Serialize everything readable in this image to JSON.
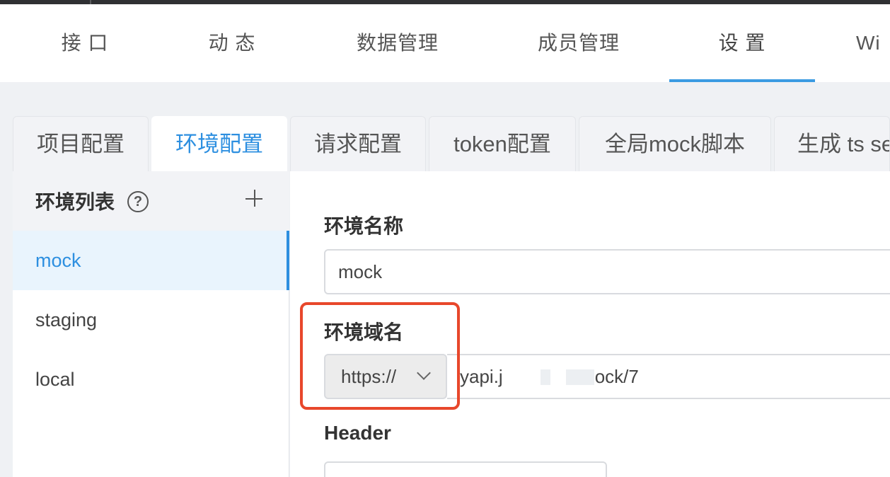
{
  "nav": {
    "items": [
      {
        "label": "接 口"
      },
      {
        "label": "动 态"
      },
      {
        "label": "数据管理"
      },
      {
        "label": "成员管理"
      },
      {
        "label": "设 置"
      },
      {
        "label": "Wi"
      }
    ],
    "active_index": 4
  },
  "tabs": [
    {
      "label": "项目配置"
    },
    {
      "label": "环境配置"
    },
    {
      "label": "请求配置"
    },
    {
      "label": "token配置"
    },
    {
      "label": "全局mock脚本"
    },
    {
      "label": "生成 ts se"
    }
  ],
  "env_list": {
    "title": "环境列表",
    "help_symbol": "?",
    "items": [
      {
        "label": "mock"
      },
      {
        "label": "staging"
      },
      {
        "label": "local"
      }
    ]
  },
  "form": {
    "name_label": "环境名称",
    "name_value": "mock",
    "domain_label": "环境域名",
    "protocol_value": "https://",
    "domain_value": "yapi.j              /mock/7",
    "header_label": "Header"
  },
  "colors": {
    "accent": "#2d8fe0",
    "highlight": "#e8472b"
  }
}
